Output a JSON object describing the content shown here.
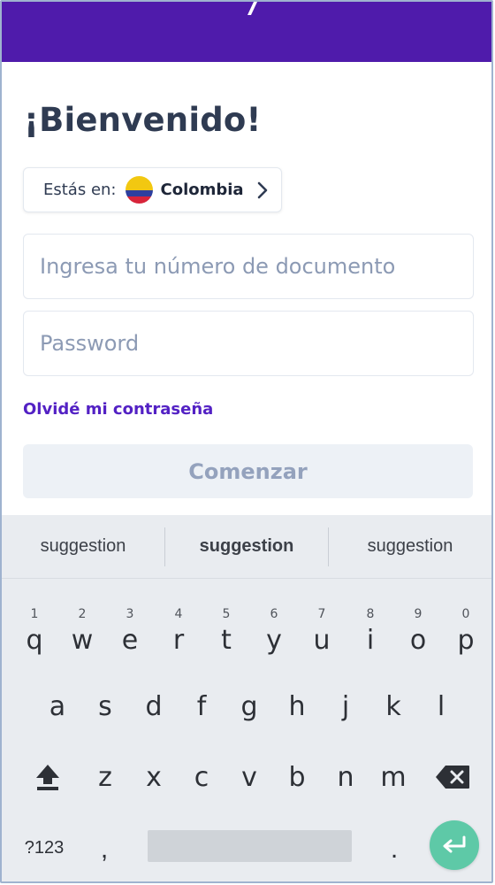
{
  "header": {
    "logo_icon": "logo-fragment-icon",
    "bg_color": "#4f1bab"
  },
  "login": {
    "title": "¡Bienvenido!",
    "country_prefix": "Estás en:",
    "country_name": "Colombia",
    "document_placeholder": "Ingresa tu número de documento",
    "password_placeholder": "Password",
    "forgot_password": "Olvidé mi contraseña",
    "submit": "Comenzar"
  },
  "colors": {
    "accent": "#5321c4",
    "disabled_button_bg": "#edf1f6",
    "disabled_button_text": "#94a2bd",
    "enter_key": "#5ec9a7"
  },
  "keyboard": {
    "suggestions": [
      "suggestion",
      "suggestion",
      "suggestion"
    ],
    "row1": [
      "q",
      "w",
      "e",
      "r",
      "t",
      "y",
      "u",
      "i",
      "o",
      "p"
    ],
    "row1_hints": [
      "1",
      "2",
      "3",
      "4",
      "5",
      "6",
      "7",
      "8",
      "9",
      "0"
    ],
    "row2": [
      "a",
      "s",
      "d",
      "f",
      "g",
      "h",
      "j",
      "k",
      "l"
    ],
    "row3": [
      "z",
      "x",
      "c",
      "v",
      "b",
      "n",
      "m"
    ],
    "symbols_key": "?123",
    "comma": ",",
    "period": "."
  }
}
